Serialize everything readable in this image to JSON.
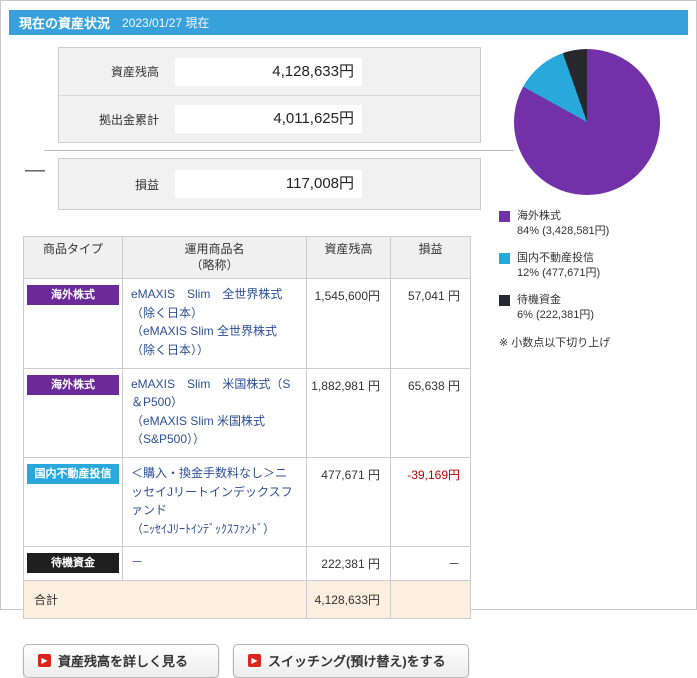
{
  "header": {
    "title": "現在の資産状況",
    "date": "2023/01/27 現在"
  },
  "summary": {
    "balance_label": "資産残高",
    "balance_value": "4,128,633円",
    "contribution_label": "拠出金累計",
    "contribution_value": "4,011,625円",
    "operator_minus": "—",
    "pl_label": "損益",
    "pl_value": "117,008円"
  },
  "chart_data": {
    "type": "pie",
    "title": "",
    "slices": [
      {
        "label": "海外株式",
        "detail": "84% (3,428,581円)",
        "value_yen": 3428581,
        "pct_display": 84,
        "pct_actual": 83.044,
        "color": "#7231a8"
      },
      {
        "label": "国内不動産投信",
        "detail": "12% (477,671円)",
        "value_yen": 477671,
        "pct_display": 12,
        "pct_actual": 11.57,
        "color": "#29a8dc"
      },
      {
        "label": "待機資金",
        "detail": "6% (222,381円)",
        "value_yen": 222381,
        "pct_display": 6,
        "pct_actual": 5.386,
        "color": "#26282e"
      }
    ],
    "note": "※ 小数点以下切り上げ",
    "legend_position": "below"
  },
  "table": {
    "headers": {
      "type": "商品タイプ",
      "name_line1": "運用商品名",
      "name_line2": "（略称）",
      "balance": "資産残高",
      "pl": "損益"
    },
    "rows": [
      {
        "type": "海外株式",
        "type_color": "#6c2a99",
        "name": "eMAXIS　Slim　全世界株式（除く日本）",
        "subname": "（eMAXIS Slim 全世界株式（除く日本））",
        "balance": "1,545,600円",
        "pl": "57,041 円"
      },
      {
        "type": "海外株式",
        "type_color": "#6c2a99",
        "name": "eMAXIS　Slim　米国株式（S＆P500）",
        "subname": "（eMAXIS Slim 米国株式（S&P500））",
        "balance": "1,882,981 円",
        "pl": "65,638 円"
      },
      {
        "type": "国内不動産投信",
        "type_color": "#29a8dc",
        "name": "＜購入・換金手数料なし＞ニッセイJリートインデックスファンド",
        "subname": "（ﾆｯｾｲJﾘｰﾄｲﾝﾃﾞｯｸｽﾌｧﾝﾄﾞ）",
        "balance": "477,671 円",
        "pl": "-39,169円"
      },
      {
        "type": "待機資金",
        "type_color": "#1e1e1e",
        "name": "－",
        "subname": "",
        "balance": "222,381 円",
        "pl": "－"
      }
    ],
    "total_label": "合計",
    "total_balance": "4,128,633円"
  },
  "buttons": {
    "detail_label": "資産残高を詳しく見る",
    "switching_label": "スイッチング(預け替え)をする"
  },
  "icons": {
    "red_arrow": "▶"
  },
  "colors": {
    "header_bar": "#38a1dc",
    "negative": "#c00000",
    "total_row_bg": "#fcefdf",
    "product_link": "#2d4f96"
  }
}
